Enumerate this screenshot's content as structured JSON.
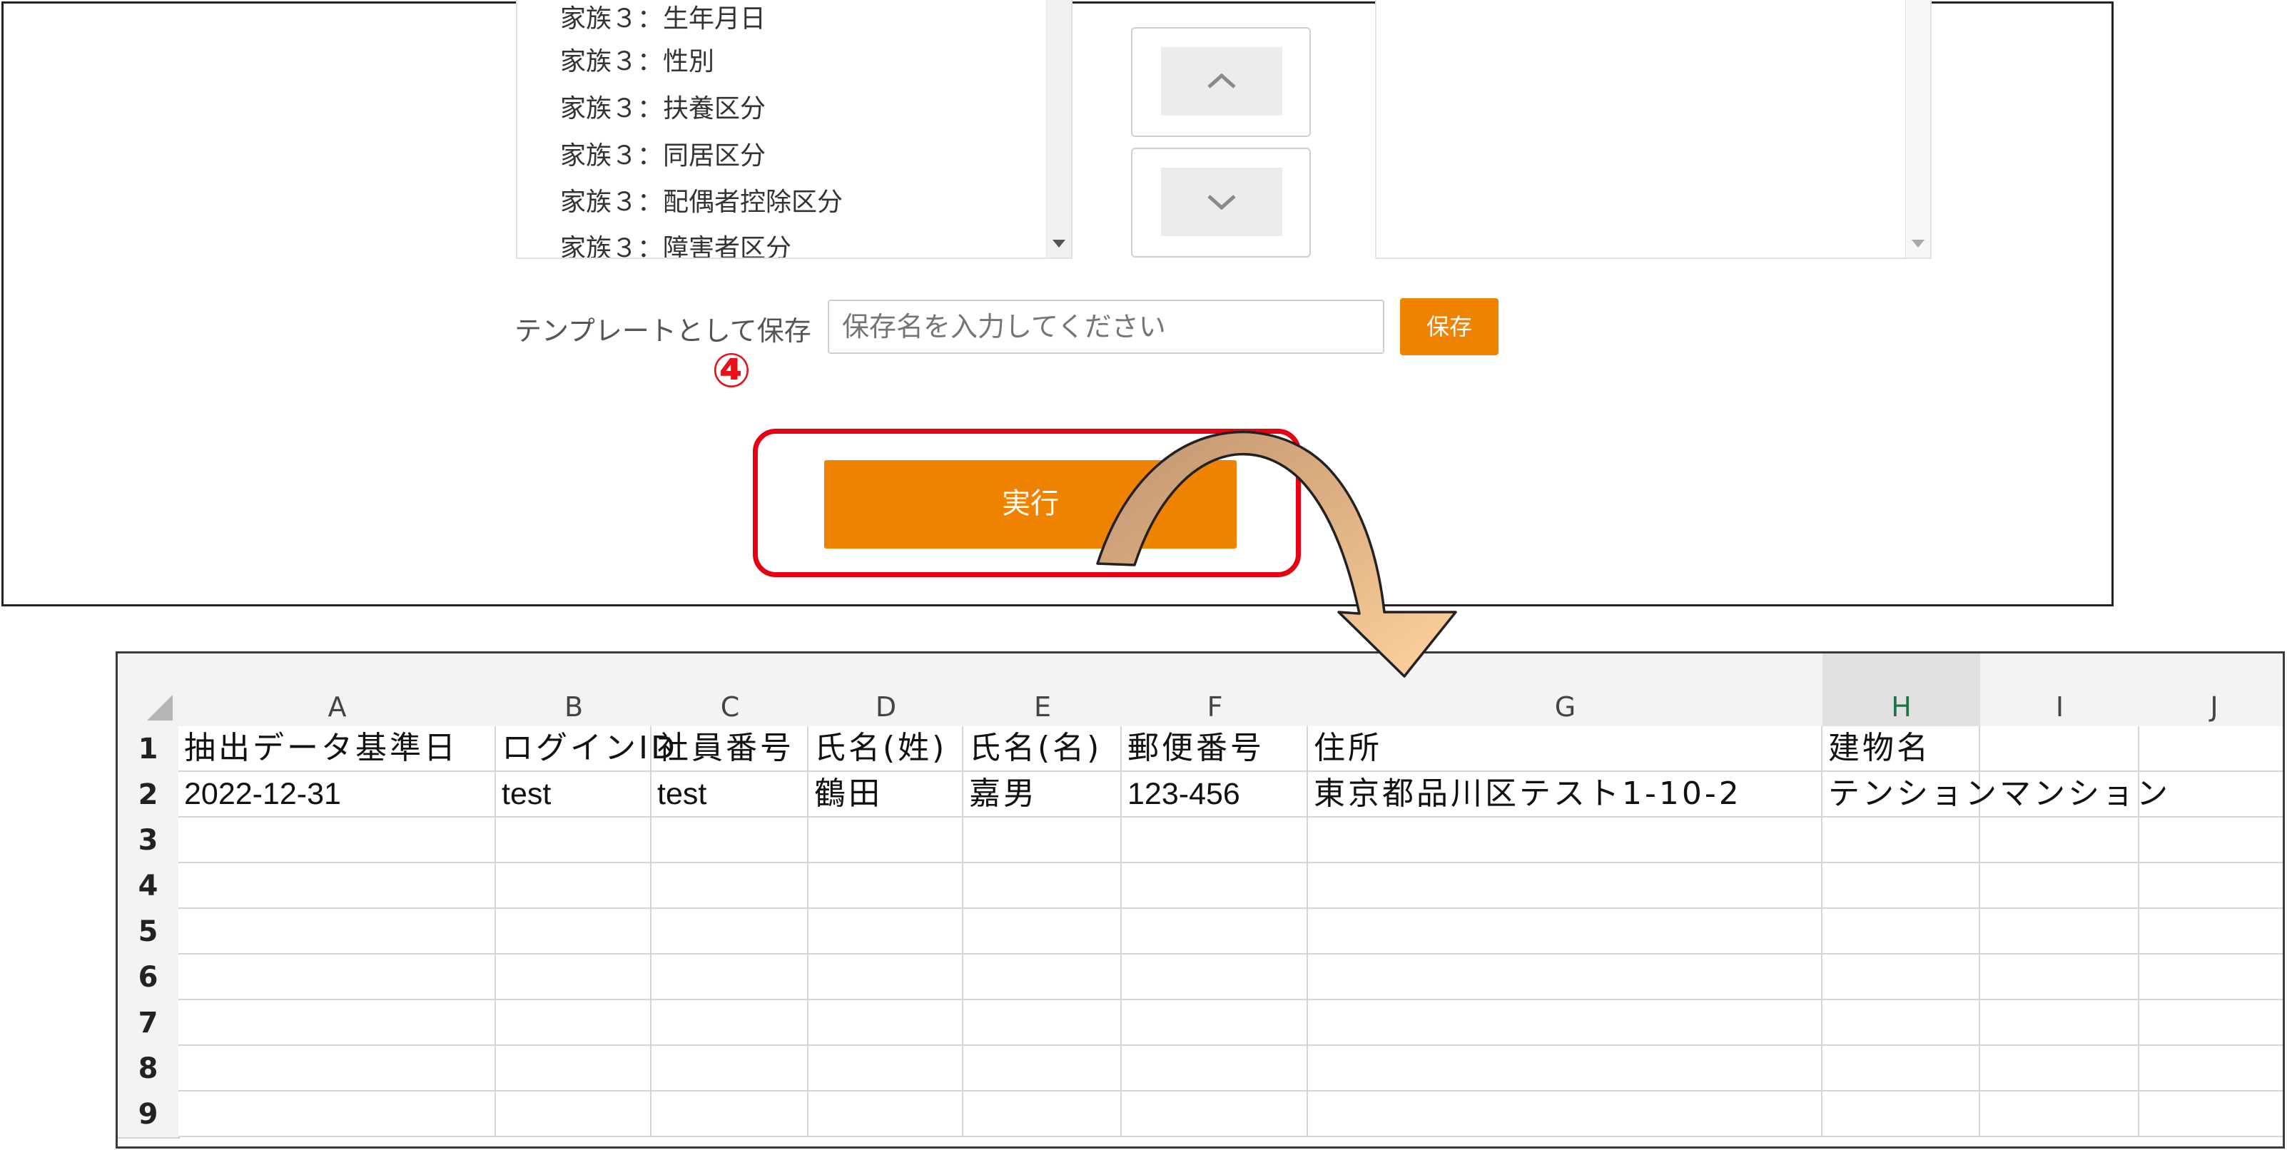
{
  "field_list": {
    "items": [
      "家族３：生年月日",
      "家族３：性別",
      "家族３：扶養区分",
      "家族３：同居区分",
      "家族３：配偶者控除区分",
      "家族３：障害者区分"
    ]
  },
  "move_buttons": {
    "up_icon": "chevron-up-icon",
    "down_icon": "chevron-down-icon"
  },
  "template": {
    "label": "テンプレートとして保存",
    "input_placeholder": "保存名を入力してください",
    "save_label": "保存"
  },
  "annotation": {
    "step_number": "④"
  },
  "execute_label": "実行",
  "spreadsheet": {
    "columns": [
      "A",
      "B",
      "C",
      "D",
      "E",
      "F",
      "G",
      "H",
      "I",
      "J"
    ],
    "selected_column": "H",
    "row_numbers": [
      "1",
      "2",
      "3",
      "4",
      "5",
      "6",
      "7",
      "8",
      "9"
    ],
    "header_row": [
      "抽出データ基準日",
      "ログインID",
      "社員番号",
      "氏名(姓)",
      "氏名(名)",
      "郵便番号",
      "住所",
      "建物名",
      "",
      ""
    ],
    "data_row": [
      "2022-12-31",
      "test",
      "test",
      "鶴田",
      "嘉男",
      "123-456",
      "東京都品川区テスト1-10-2",
      "テンションマンション",
      "",
      ""
    ]
  },
  "colors": {
    "accent": "#ef8200",
    "highlight": "#e60012",
    "excel_green": "#217346"
  }
}
